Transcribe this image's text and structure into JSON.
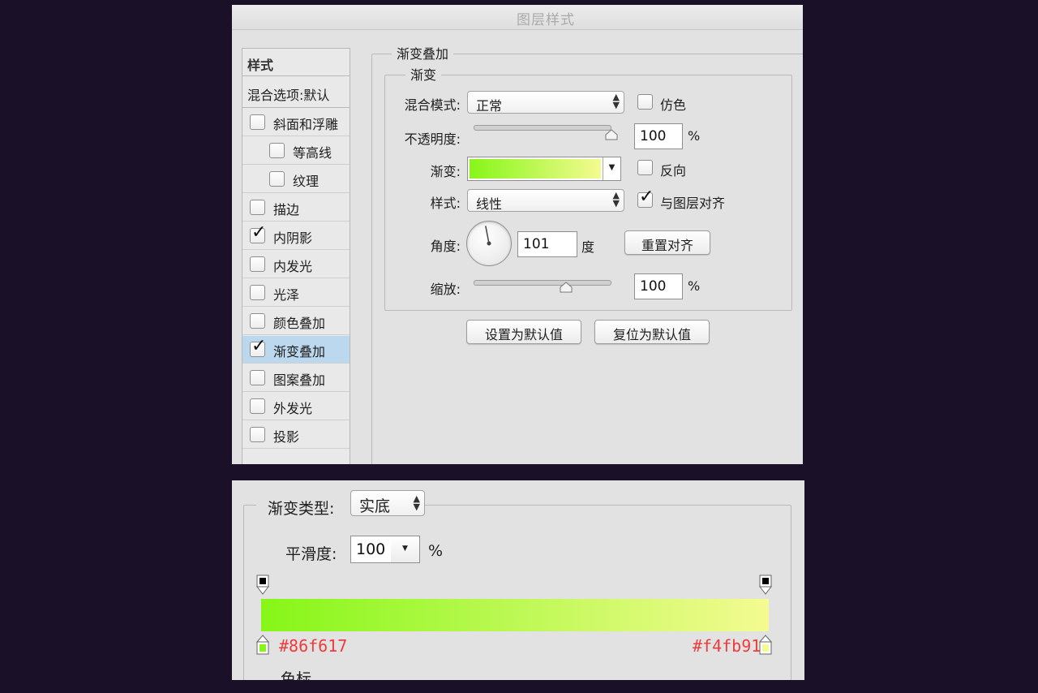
{
  "dialog": {
    "title": "图层样式",
    "style_list": {
      "header": "样式",
      "blend_options": "混合选项:默认",
      "items": [
        {
          "label": "斜面和浮雕",
          "checked": false,
          "indent": false,
          "selected": false
        },
        {
          "label": "等高线",
          "checked": false,
          "indent": true,
          "selected": false
        },
        {
          "label": "纹理",
          "checked": false,
          "indent": true,
          "selected": false
        },
        {
          "label": "描边",
          "checked": false,
          "indent": false,
          "selected": false
        },
        {
          "label": "内阴影",
          "checked": true,
          "indent": false,
          "selected": false
        },
        {
          "label": "内发光",
          "checked": false,
          "indent": false,
          "selected": false
        },
        {
          "label": "光泽",
          "checked": false,
          "indent": false,
          "selected": false
        },
        {
          "label": "颜色叠加",
          "checked": false,
          "indent": false,
          "selected": false
        },
        {
          "label": "渐变叠加",
          "checked": true,
          "indent": false,
          "selected": true
        },
        {
          "label": "图案叠加",
          "checked": false,
          "indent": false,
          "selected": false
        },
        {
          "label": "外发光",
          "checked": false,
          "indent": false,
          "selected": false
        },
        {
          "label": "投影",
          "checked": false,
          "indent": false,
          "selected": false
        }
      ]
    },
    "section_title": "渐变叠加",
    "group_title": "渐变",
    "blend_mode": {
      "label": "混合模式:",
      "value": "正常"
    },
    "dither": {
      "label": "仿色",
      "checked": false
    },
    "opacity": {
      "label": "不透明度:",
      "value": "100",
      "unit": "%",
      "level": 100
    },
    "gradient": {
      "label": "渐变:"
    },
    "reverse": {
      "label": "反向",
      "checked": false
    },
    "style": {
      "label": "样式:",
      "value": "线性"
    },
    "align": {
      "label": "与图层对齐",
      "checked": true
    },
    "angle": {
      "label": "角度:",
      "value": "101",
      "unit": "度",
      "degrees": 101
    },
    "reset_align_button": "重置对齐",
    "scale": {
      "label": "缩放:",
      "value": "100",
      "unit": "%",
      "level_fraction": 0.68
    },
    "set_default_button": "设置为默认值",
    "reset_default_button": "复位为默认值"
  },
  "editor": {
    "type": {
      "label": "渐变类型:",
      "value": "实底"
    },
    "smoothness": {
      "label": "平滑度:",
      "value": "100",
      "unit": "%"
    },
    "start_color": "#86f617",
    "end_color": "#f4fb91",
    "start_hex": "#86f617",
    "end_hex": "#f4fb91",
    "hex_color": "#ee3b3b",
    "color_stops_label": "色标"
  }
}
